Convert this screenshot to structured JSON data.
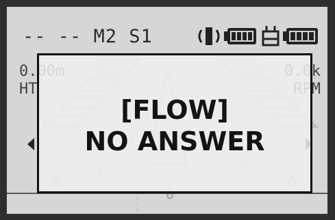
{
  "status_bar": {
    "mode_text": "-- -- M2 S1",
    "antenna_icon": "antenna-icon",
    "battery_icon_1": "battery-icon",
    "link_icon": "receiver-icon",
    "battery_icon_2": "battery-icon"
  },
  "telemetry": {
    "left_value": "0.00m",
    "left_label": "HT",
    "right_value": "0.0k",
    "right_label": "RPM",
    "bottom_left": "0",
    "bottom_center": "0",
    "bottom_right": "0"
  },
  "dialog": {
    "title": "[FLOW]",
    "message": "NO ANSWER"
  }
}
